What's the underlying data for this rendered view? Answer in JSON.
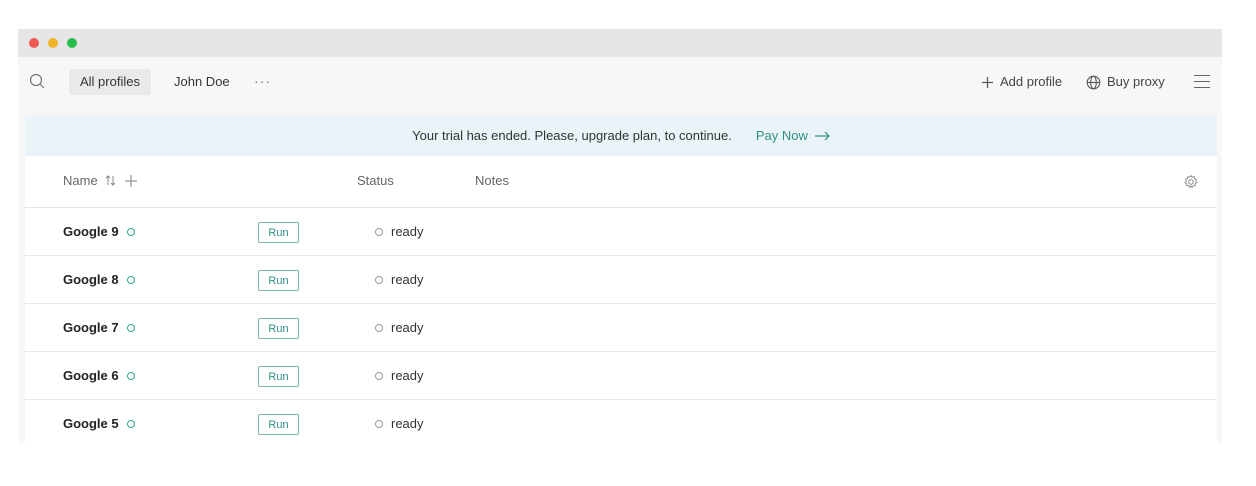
{
  "toolbar": {
    "tabs": [
      {
        "label": "All profiles",
        "active": true
      },
      {
        "label": "John Doe",
        "active": false
      }
    ],
    "more_label": "···",
    "add_profile_label": "Add profile",
    "buy_proxy_label": "Buy proxy"
  },
  "banner": {
    "message": "Your trial has ended. Please, upgrade plan, to continue.",
    "pay_label": "Pay Now"
  },
  "table": {
    "columns": {
      "name": "Name",
      "status": "Status",
      "notes": "Notes"
    },
    "run_label": "Run",
    "rows": [
      {
        "name": "Google 9",
        "status": "ready"
      },
      {
        "name": "Google 8",
        "status": "ready"
      },
      {
        "name": "Google 7",
        "status": "ready"
      },
      {
        "name": "Google 6",
        "status": "ready"
      },
      {
        "name": "Google 5",
        "status": "ready"
      }
    ]
  },
  "colors": {
    "accent": "#2f8f84",
    "banner_bg": "#eaf3f8",
    "titlebar_bg": "#e6e6e6"
  },
  "icons": [
    "search-icon",
    "plus-icon",
    "globe-icon",
    "hamburger-menu-icon",
    "sort-icon",
    "gear-icon",
    "arrow-right-icon"
  ]
}
